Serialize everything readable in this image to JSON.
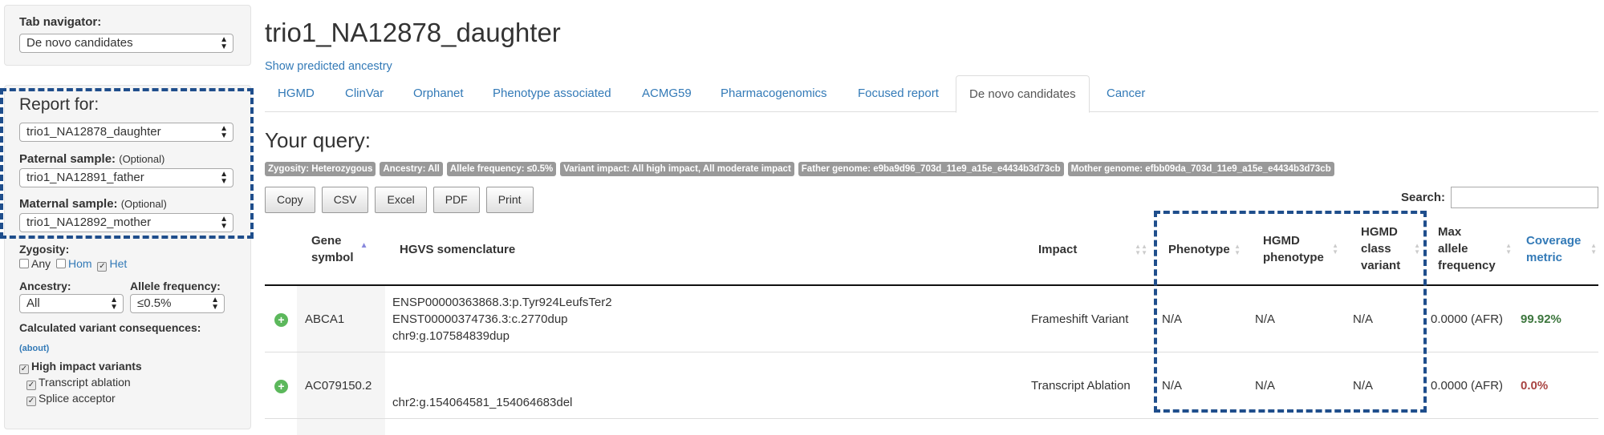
{
  "sidebar": {
    "tab_navigator_label": "Tab navigator:",
    "tab_navigator_value": "De novo candidates",
    "report_for_label": "Report for:",
    "report_for_value": "trio1_NA12878_daughter",
    "paternal_label": "Paternal sample:",
    "paternal_optional": "(Optional)",
    "paternal_value": "trio1_NA12891_father",
    "maternal_label": "Maternal sample:",
    "maternal_optional": "(Optional)",
    "maternal_value": "trio1_NA12892_mother",
    "zygosity_label": "Zygosity:",
    "zygosity_any": "Any",
    "zygosity_hom": "Hom",
    "zygosity_het": "Het",
    "ancestry_label": "Ancestry:",
    "ancestry_value": "All",
    "allele_freq_label": "Allele frequency:",
    "allele_freq_value": "≤0.5%",
    "consequences_label": "Calculated variant consequences:",
    "about_link": "(about)",
    "high_impact": "High impact variants",
    "transcript_ablation": "Transcript ablation",
    "splice_acceptor": "Splice acceptor"
  },
  "header": {
    "title": "trio1_NA12878_daughter",
    "ancestry_link": "Show predicted ancestry"
  },
  "tabs": [
    "HGMD",
    "ClinVar",
    "Orphanet",
    "Phenotype associated",
    "ACMG59",
    "Pharmacogenomics",
    "Focused report",
    "De novo candidates",
    "Cancer"
  ],
  "query": {
    "title": "Your query:",
    "badges": [
      "Zygosity: Heterozygous",
      "Ancestry: All",
      "Allele frequency: ≤0.5%",
      "Variant impact: All high impact, All moderate impact",
      "Father genome: e9ba9d96_703d_11e9_a15e_e4434b3d73cb",
      "Mother genome: efbb09da_703d_11e9_a15e_e4434b3d73cb"
    ]
  },
  "toolbar": {
    "copy": "Copy",
    "csv": "CSV",
    "excel": "Excel",
    "pdf": "PDF",
    "print": "Print",
    "search_label": "Search:"
  },
  "table": {
    "headers": {
      "gene_1": "Gene",
      "gene_2": "symbol",
      "hgvs": "HGVS somenclature",
      "impact": "Impact",
      "phenotype": "Phenotype",
      "hgmd_ph_1": "HGMD",
      "hgmd_ph_2": "phenotype",
      "hgmd_cl_1": "HGMD",
      "hgmd_cl_2": "class",
      "hgmd_cl_3": "variant",
      "maf_1": "Max",
      "maf_2": "allele",
      "maf_3": "frequency",
      "cov_1": "Coverage",
      "cov_2": "metric"
    },
    "rows": [
      {
        "gene": "ABCA1",
        "hgvs_1": "ENSP00000363868.3:p.Tyr924LeufsTer2",
        "hgvs_2": "ENST00000374736.3:c.2770dup",
        "hgvs_3": "chr9:g.107584839dup",
        "impact": "Frameshift Variant",
        "phenotype": "N/A",
        "hgmd_phenotype": "N/A",
        "hgmd_class": "N/A",
        "max_af": "0.0000 (AFR)",
        "coverage": "99.92%"
      },
      {
        "gene": "AC079150.2",
        "hgvs_3": "chr2:g.154064581_154064683del",
        "impact": "Transcript Ablation",
        "phenotype": "N/A",
        "hgmd_phenotype": "N/A",
        "hgmd_class": "N/A",
        "max_af": "0.0000 (AFR)",
        "coverage": "0.0%"
      }
    ]
  },
  "colors": {
    "link": "#337ab7",
    "highlight_box": "#1f4e8c",
    "coverage_good": "#3c763d",
    "coverage_bad": "#a94442"
  }
}
